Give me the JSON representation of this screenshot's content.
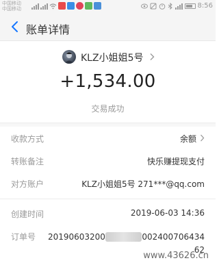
{
  "status_bar": {
    "carrier_1": "中国移动",
    "carrier_2": "中国移动",
    "time": "8:56"
  },
  "nav": {
    "title": "账单详情"
  },
  "header": {
    "payee_name": "KLZ小姐姐5号",
    "amount": "+1,534.00",
    "status": "交易成功"
  },
  "details": [
    {
      "label": "收款方式",
      "value": "余额"
    },
    {
      "label": "转账备注",
      "value": "快乐赚提现支付"
    },
    {
      "label": "对方账户",
      "value": "KLZ小姐姐5号 271***@qq.com"
    }
  ],
  "meta": {
    "created_label": "创建时间",
    "created_value": "2019-06-03 14:36",
    "order_label": "订单号",
    "order_prefix": "20190603200",
    "order_suffix": "002400706434",
    "order_tail": "62"
  },
  "watermark": "www.43626.cn",
  "colors": {
    "accent": "#1677ff",
    "label_gray": "#9a9a9a",
    "text_dark": "#333333"
  }
}
